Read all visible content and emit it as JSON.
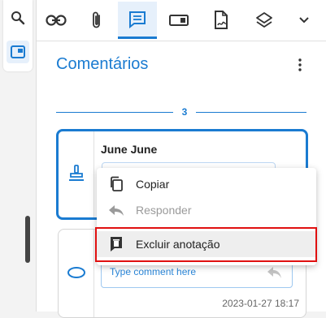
{
  "panel": {
    "title": "Comentários",
    "count": "3"
  },
  "toolbar": {
    "items": [
      {
        "icon": "link-icon"
      },
      {
        "icon": "paperclip-icon"
      },
      {
        "icon": "comment-icon",
        "active": true
      },
      {
        "icon": "form-field-icon"
      },
      {
        "icon": "signature-file-icon"
      },
      {
        "icon": "layers-icon"
      },
      {
        "icon": "chevron-down-icon"
      }
    ]
  },
  "left_panel": {
    "items": [
      {
        "icon": "search-icon"
      },
      {
        "icon": "thumbnails-icon",
        "active": true
      }
    ]
  },
  "annotations": [
    {
      "author": "June June",
      "type_icon": "stamp-icon"
    },
    {
      "type_icon": "ellipse-icon",
      "placeholder": "Type comment here",
      "timestamp": "2023-01-27 18:17"
    }
  ],
  "context_menu": {
    "copy": "Copiar",
    "reply": "Responder",
    "delete": "Excluir anotação"
  },
  "colors": {
    "accent": "#1a7bd1",
    "highlight": "#e01010"
  }
}
